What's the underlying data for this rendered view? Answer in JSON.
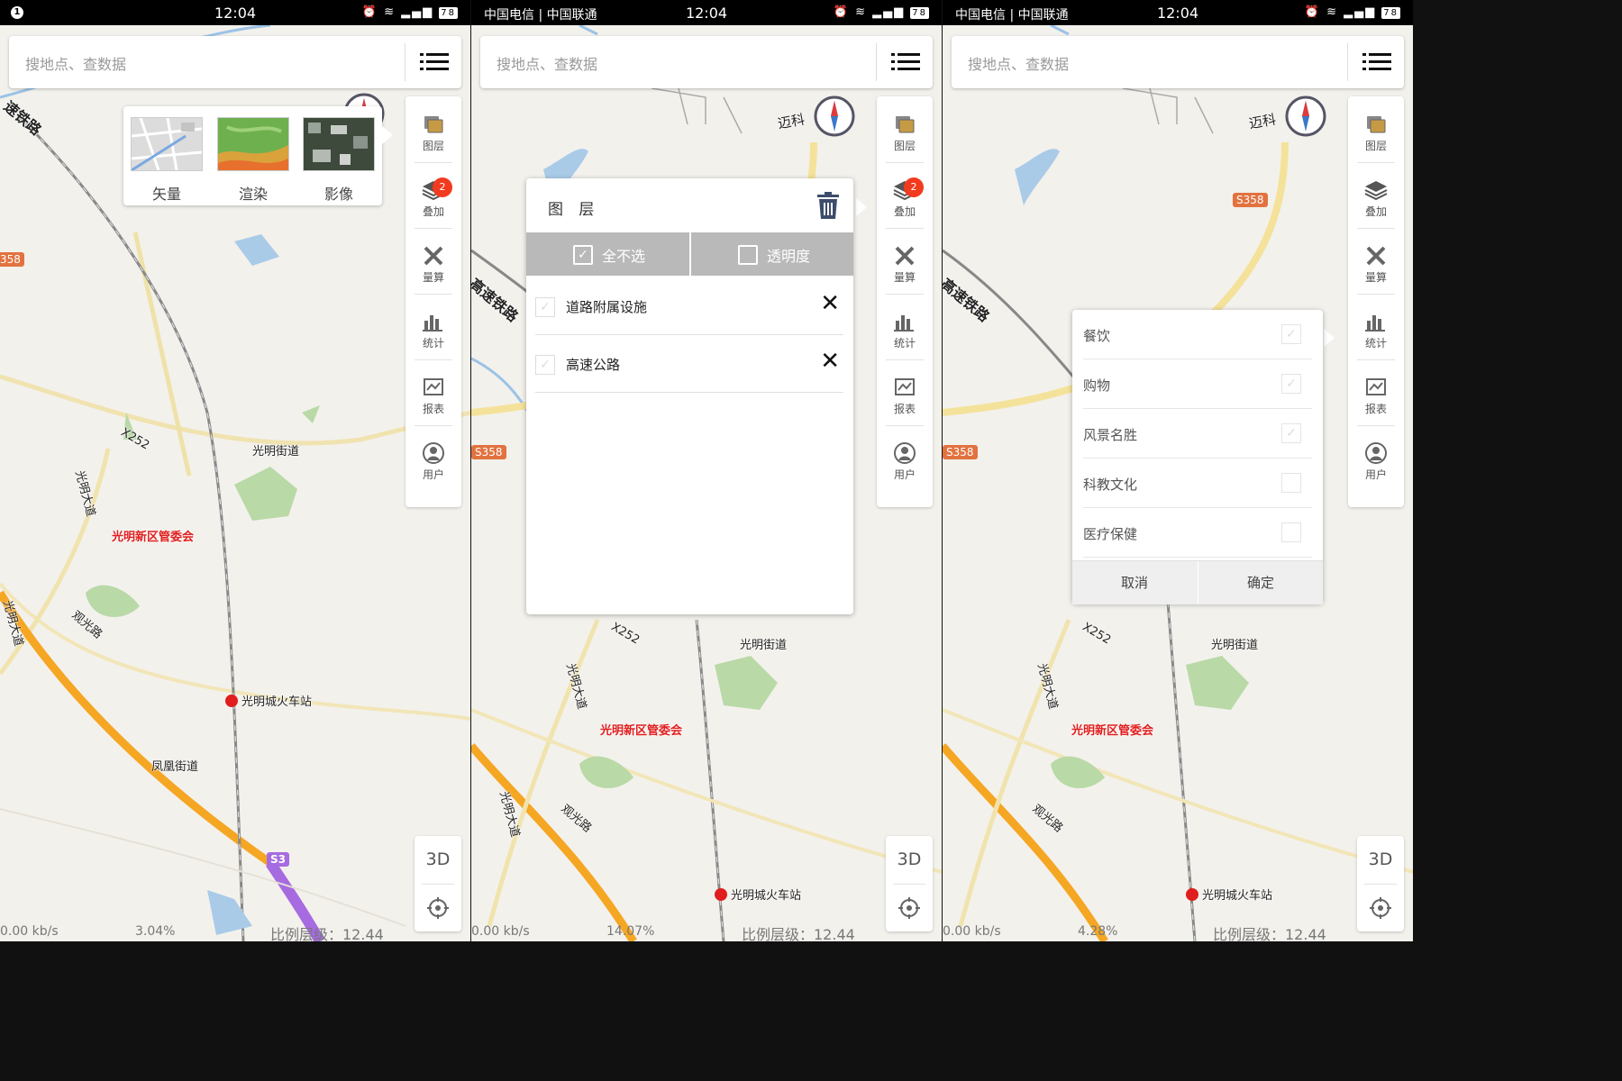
{
  "screens": [
    {
      "status": {
        "left": "",
        "time": "12:04",
        "battery": "78"
      },
      "search_placeholder": "搜地点、查数据",
      "bottom": {
        "speed": "0.00 kb/s",
        "percent": "3.04%",
        "scale": "比例层级：12.44"
      },
      "map_labels": {
        "rail": "速铁路",
        "street": "光明街道",
        "x252": "X252",
        "admin": "光明新区管委会",
        "station": "光明城火车站",
        "guanguang": "观光路",
        "fenghuang": "凤凰街道",
        "guangming_rd": "光明大道",
        "guangming_rd2": "光明大道",
        "s358": "358",
        "s3": "S3"
      }
    },
    {
      "status": {
        "left": "中国电信 | 中国联通",
        "time": "12:04",
        "battery": "78"
      },
      "search_placeholder": "搜地点、查数据",
      "bottom": {
        "speed": "0.00 kb/s",
        "percent": "14.07%",
        "scale": "比例层级：12.44"
      },
      "map_labels": {
        "rail": "高速铁路",
        "street": "光明街道",
        "x252": "X252",
        "admin": "光明新区管委会",
        "station": "光明城火车站",
        "guanguang": "观光路",
        "guangming_rd": "光明大道",
        "guangming_rd2": "光明大道",
        "s358": "S358",
        "maike": "迈科"
      }
    },
    {
      "status": {
        "left": "中国电信 | 中国联通",
        "time": "12:04",
        "battery": "78"
      },
      "search_placeholder": "搜地点、查数据",
      "bottom": {
        "speed": "0.00 kb/s",
        "percent": "4.28%",
        "scale": "比例层级：12.44"
      },
      "map_labels": {
        "rail": "高速铁路",
        "street": "光明街道",
        "x252": "X252",
        "admin": "光明新区管委会",
        "station": "光明城火车站",
        "guanguang": "观光路",
        "guangming_rd": "光明大道",
        "s358": "S358",
        "s358b": "S358",
        "maike": "迈科"
      }
    }
  ],
  "toolbar": {
    "items": [
      {
        "label": "图层",
        "icon": "layers-icon"
      },
      {
        "label": "叠加",
        "icon": "overlay-icon"
      },
      {
        "label": "量算",
        "icon": "measure-icon"
      },
      {
        "label": "统计",
        "icon": "statistics-icon"
      },
      {
        "label": "报表",
        "icon": "report-icon"
      },
      {
        "label": "用户",
        "icon": "user-icon"
      }
    ],
    "overlay_badge": "2",
    "btn_3d": "3D"
  },
  "basemap_popup": {
    "options": [
      "矢量",
      "渲染",
      "影像"
    ]
  },
  "layer_dialog": {
    "title": "图 层",
    "tabs": {
      "deselect_all": "全不选",
      "opacity": "透明度"
    },
    "layers": [
      "道路附属设施",
      "高速公路"
    ]
  },
  "poi_dialog": {
    "categories": [
      {
        "label": "餐饮",
        "checked": true
      },
      {
        "label": "购物",
        "checked": true
      },
      {
        "label": "风景名胜",
        "checked": true
      },
      {
        "label": "科教文化",
        "checked": false
      },
      {
        "label": "医疗保健",
        "checked": false
      }
    ],
    "cancel": "取消",
    "confirm": "确定"
  },
  "colors": {
    "accent_red": "#f23a1f",
    "road_orange": "#f5a623",
    "poi_red": "#e01e1e",
    "tab_gray": "#b9b9b9",
    "route_purple": "#a66be0"
  }
}
